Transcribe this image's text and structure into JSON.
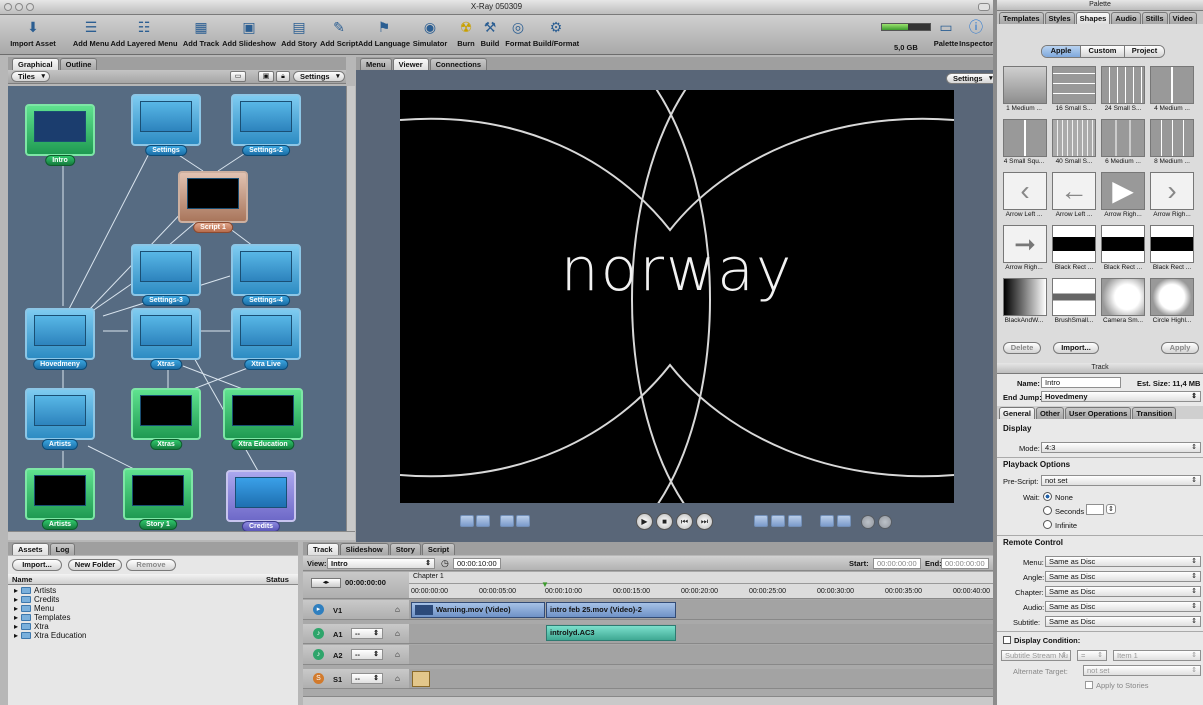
{
  "window": {
    "title": "X-Ray 050309"
  },
  "toolbar": {
    "items": [
      {
        "label": "Import Asset",
        "icon": "import-icon"
      },
      {
        "label": "Add Menu",
        "icon": "menu-icon"
      },
      {
        "label": "Add Layered Menu",
        "icon": "layered-menu-icon"
      },
      {
        "label": "Add Track",
        "icon": "track-icon"
      },
      {
        "label": "Add Slideshow",
        "icon": "slideshow-icon"
      },
      {
        "label": "Add Story",
        "icon": "story-icon"
      },
      {
        "label": "Add Script",
        "icon": "script-icon"
      },
      {
        "label": "Add Language",
        "icon": "language-icon"
      },
      {
        "label": "Simulator",
        "icon": "simulator-icon"
      },
      {
        "label": "Burn",
        "icon": "burn-icon"
      },
      {
        "label": "Build",
        "icon": "build-icon"
      },
      {
        "label": "Format",
        "icon": "format-icon"
      },
      {
        "label": "Build/Format",
        "icon": "build-format-icon"
      }
    ],
    "disc_size": "5,0 GB",
    "disc_fill": 0.55,
    "palette_label": "Palette",
    "inspector_label": "Inspector"
  },
  "left_tabs": [
    "Graphical",
    "Outline"
  ],
  "graph": {
    "view_popup": "Tiles",
    "settings_popup": "Settings",
    "nodes": [
      {
        "label": "Intro",
        "style": "g"
      },
      {
        "label": "Settings",
        "style": "blue"
      },
      {
        "label": "Settings-2",
        "style": "blue"
      },
      {
        "label": "Script 1",
        "style": "b"
      },
      {
        "label": "Settings-3",
        "style": "blue"
      },
      {
        "label": "Settings-4",
        "style": "blue"
      },
      {
        "label": "Hovedmeny",
        "style": "blue"
      },
      {
        "label": "Xtras",
        "style": "blue"
      },
      {
        "label": "Xtra Live",
        "style": "blue"
      },
      {
        "label": "Artists",
        "style": "blue"
      },
      {
        "label": "Xtras",
        "style": "g"
      },
      {
        "label": "Xtra Education",
        "style": "g"
      },
      {
        "label": "Artists",
        "style": "g"
      },
      {
        "label": "Story 1",
        "style": "g"
      },
      {
        "label": "Credits",
        "style": "v"
      }
    ]
  },
  "viewer": {
    "tabs": [
      "Menu",
      "Viewer",
      "Connections"
    ],
    "settings_popup": "Settings",
    "screen_text": "norway"
  },
  "assets": {
    "tabs": [
      "Assets",
      "Log"
    ],
    "buttons": {
      "import": "Import...",
      "new_folder": "New Folder",
      "remove": "Remove"
    },
    "columns": {
      "name": "Name",
      "status": "Status"
    },
    "items": [
      "Artists",
      "Credits",
      "Menu",
      "Templates",
      "Xtra",
      "Xtra Education"
    ]
  },
  "timeline": {
    "tabs": [
      "Track",
      "Slideshow",
      "Story",
      "Script"
    ],
    "view_label": "View:",
    "view_value": "Intro",
    "time_value": "00:00:10:00",
    "start_label": "Start:",
    "start_value": "00:00:00:00",
    "end_label": "End:",
    "end_value": "00:00:00:00",
    "playhead": "00:00:00:00",
    "chapter": "Chapter 1",
    "ruler": [
      "00:00:00:00",
      "00:00:05:00",
      "00:00:10:00",
      "00:00:15:00",
      "00:00:20:00",
      "00:00:25:00",
      "00:00:30:00",
      "00:00:35:00",
      "00:00:40:00"
    ],
    "tracks": [
      {
        "name": "V1"
      },
      {
        "name": "A1",
        "popup": "--"
      },
      {
        "name": "A2",
        "popup": "--"
      },
      {
        "name": "S1",
        "popup": "--"
      }
    ],
    "clips": {
      "v1a": "Warning.mov (Video)",
      "v1b": "intro feb 25.mov (Video)-2",
      "a1": "introlyd.AC3"
    }
  },
  "palette": {
    "title": "Palette",
    "tabs": [
      "Templates",
      "Styles",
      "Shapes",
      "Audio",
      "Stills",
      "Video"
    ],
    "segments": [
      "Apple",
      "Custom",
      "Project"
    ],
    "shapes": [
      "1 Medium ...",
      "16 Small S...",
      "24 Small S...",
      "4 Medium ...",
      "4 Small Squ...",
      "40 Small S...",
      "6 Medium ...",
      "8 Medium ...",
      "Arrow Left ...",
      "Arrow Left ...",
      "Arrow Righ...",
      "Arrow Righ...",
      "Arrow Righ...",
      "Black Rect ...",
      "Black Rect ...",
      "Black Rect ...",
      "BlackAndW...",
      "BrushSmall...",
      "Camera Sm...",
      "Circle Highl..."
    ],
    "buttons": {
      "delete": "Delete",
      "import": "Import...",
      "apply": "Apply"
    }
  },
  "inspector": {
    "title": "Track",
    "name_label": "Name:",
    "name_value": "Intro",
    "est_size": "Est. Size: 11,4 MB",
    "end_jump_label": "End Jump:",
    "end_jump_value": "Hovedmeny",
    "tabs": [
      "General",
      "Other",
      "User Operations",
      "Transition"
    ],
    "display_title": "Display",
    "mode_label": "Mode:",
    "mode_value": "4:3",
    "playback_title": "Playback Options",
    "prescript_label": "Pre-Script:",
    "prescript_value": "not set",
    "wait_label": "Wait:",
    "wait_options": [
      "None",
      "Seconds",
      "Infinite"
    ],
    "remote_title": "Remote Control",
    "remote_rows": [
      {
        "label": "Menu:",
        "value": "Same as Disc"
      },
      {
        "label": "Angle:",
        "value": "Same as Disc"
      },
      {
        "label": "Chapter:",
        "value": "Same as Disc"
      },
      {
        "label": "Audio:",
        "value": "Same as Disc"
      },
      {
        "label": "Subtitle:",
        "value": "Same as Disc"
      }
    ],
    "display_condition": "Display Condition:",
    "cond_a": "Subtitle Stream Nu",
    "cond_b": "=",
    "cond_c": "Item 1",
    "alt_target_label": "Alternate Target:",
    "alt_target_value": "not set",
    "apply_stories": "Apply to Stories"
  }
}
